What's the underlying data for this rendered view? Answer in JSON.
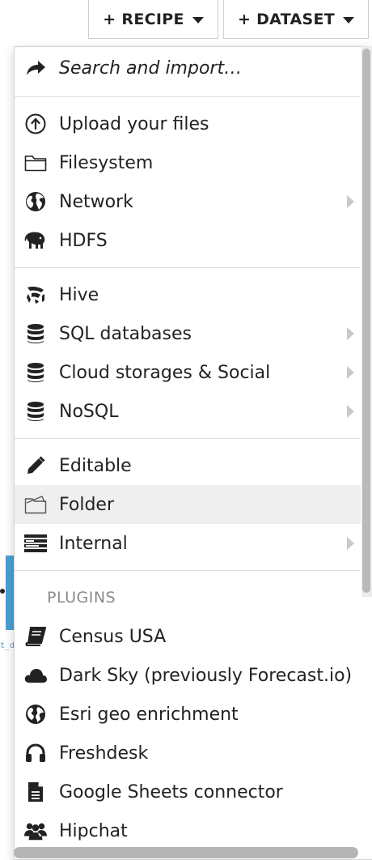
{
  "toolbar": {
    "recipe_label": "+ RECIPE",
    "dataset_label": "+ DATASET"
  },
  "background": {
    "partial_text": "t_d"
  },
  "menu": {
    "search": {
      "label": "Search and import…",
      "icon": "share-arrow-icon"
    },
    "group1": [
      {
        "label": "Upload your files",
        "icon": "upload-icon",
        "submenu": false
      },
      {
        "label": "Filesystem",
        "icon": "folder-icon",
        "submenu": false
      },
      {
        "label": "Network",
        "icon": "globe-icon",
        "submenu": true
      },
      {
        "label": "HDFS",
        "icon": "elephant-icon",
        "submenu": false
      }
    ],
    "group2": [
      {
        "label": "Hive",
        "icon": "hive-icon",
        "submenu": false
      },
      {
        "label": "SQL databases",
        "icon": "database-icon",
        "submenu": true
      },
      {
        "label": "Cloud storages & Social",
        "icon": "database-icon",
        "submenu": true
      },
      {
        "label": "NoSQL",
        "icon": "database-icon",
        "submenu": true
      }
    ],
    "group3": [
      {
        "label": "Editable",
        "icon": "pencil-icon",
        "submenu": false
      },
      {
        "label": "Folder",
        "icon": "open-folder-icon",
        "submenu": false,
        "hovered": true
      },
      {
        "label": "Internal",
        "icon": "internal-icon",
        "submenu": true
      }
    ],
    "plugins_header": "PLUGINS",
    "plugins": [
      {
        "label": "Census USA",
        "icon": "book-icon"
      },
      {
        "label": "Dark Sky (previously Forecast.io)",
        "icon": "cloud-icon"
      },
      {
        "label": "Esri geo enrichment",
        "icon": "globe-solid-icon"
      },
      {
        "label": "Freshdesk",
        "icon": "headphones-icon"
      },
      {
        "label": "Google Sheets connector",
        "icon": "file-icon"
      },
      {
        "label": "Hipchat",
        "icon": "users-icon"
      }
    ]
  },
  "colors": {
    "hover_bg": "#efefef",
    "accent_blue": "#4a9fd2",
    "chevron": "#c9c9c9",
    "section_label": "#8a8a8a"
  }
}
